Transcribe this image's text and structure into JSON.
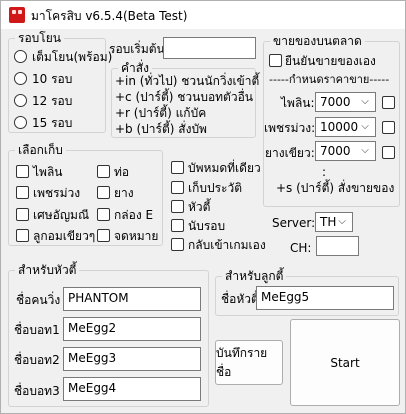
{
  "window": {
    "title": "มาโครสิบ v6.5.4(Beta Test)"
  },
  "round_group": {
    "legend": "รอบโยน",
    "options": [
      "เต็มโยน(พร้อม)",
      "10 รอบ",
      "12 รอบ",
      "15 รอบ"
    ],
    "start_round_label": "รอบเริ่มต้น",
    "start_round_value": ""
  },
  "commands": {
    "legend": "คำสั่ง",
    "lines": [
      "+in (ทั่วไป) ชวนนักวิ่งเข้าตี้",
      "+c (ปาร์ตี้) ชวนบอทตัวอื่น",
      "+r (ปาร์ตี้) แก้บัค",
      "+b (ปาร์ตี้) สั่งบัพ"
    ]
  },
  "collect_group": {
    "legend": "เลือกเก็บ",
    "items": [
      "ไพลิน",
      "ท่อ",
      "เพชรม่วง",
      "ยาง",
      "เศษอัญมณี",
      "กล่อง E",
      "ลูกอมเขียวๆ",
      "จดหมาย"
    ]
  },
  "options": {
    "items": [
      "บัพหมดที่เดียว",
      "เก็บประวัติ",
      "หัวตี้",
      "นับรอบ",
      "กลับเข้าเกมเอง"
    ]
  },
  "sell_group": {
    "legend": "ขายของบนตลาด",
    "confirm_label": "ยืนยันขายของเอง",
    "price_header": "-----กำหนดราคาขาย-----",
    "rows": [
      {
        "label": "ไพลิน:",
        "value": "7000"
      },
      {
        "label": "เพชรม่วง:",
        "value": "10000"
      },
      {
        "label": "ยางเขียว:",
        "value": "7000"
      }
    ],
    "more": ":",
    "command_note": "+s (ปาร์ตี้) สั่งขายของ"
  },
  "server": {
    "label": "Server:",
    "value": "TH"
  },
  "channel": {
    "label": "CH:",
    "value": ""
  },
  "leader_group": {
    "legend": "สำหรับหัวตี้",
    "fields": [
      {
        "label": "ชื่อคนวิ่ง",
        "value": "PHANTOM"
      },
      {
        "label": "ชื่อบอท1",
        "value": "MeEgg2"
      },
      {
        "label": "ชื่อบอท2",
        "value": "MeEgg3"
      },
      {
        "label": "ชื่อบอท3",
        "value": "MeEgg4"
      }
    ]
  },
  "member_group": {
    "legend": "สำหรับลูกตี้",
    "leader_name_label": "ชื่อหัวตี้",
    "leader_name_value": "MeEgg5"
  },
  "buttons": {
    "save": "บันทึกรายชื่อ",
    "start": "Start"
  }
}
